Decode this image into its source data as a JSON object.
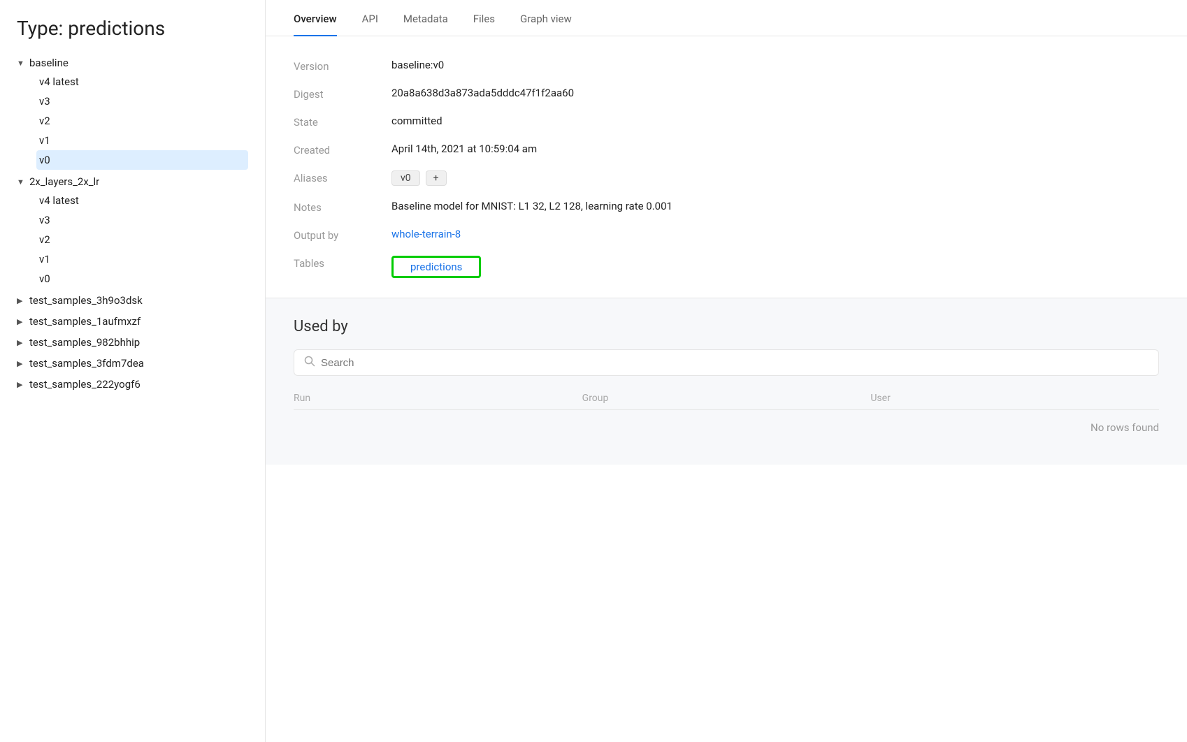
{
  "page_title": "Type: predictions",
  "sidebar": {
    "title": "Type: predictions",
    "sections": [
      {
        "id": "baseline",
        "label": "baseline",
        "expanded": true,
        "children": [
          {
            "label": "v4 latest",
            "active": false
          },
          {
            "label": "v3",
            "active": false
          },
          {
            "label": "v2",
            "active": false
          },
          {
            "label": "v1",
            "active": false
          },
          {
            "label": "v0",
            "active": true
          }
        ]
      },
      {
        "id": "2x_layers_2x_lr",
        "label": "2x_layers_2x_lr",
        "expanded": true,
        "children": [
          {
            "label": "v4 latest",
            "active": false
          },
          {
            "label": "v3",
            "active": false
          },
          {
            "label": "v2",
            "active": false
          },
          {
            "label": "v1",
            "active": false
          },
          {
            "label": "v0",
            "active": false
          }
        ]
      }
    ],
    "collapsed_items": [
      "test_samples_3h9o3dsk",
      "test_samples_1aufmxzf",
      "test_samples_982bhhip",
      "test_samples_3fdm7dea",
      "test_samples_222yogf6"
    ]
  },
  "tabs": [
    {
      "label": "Overview",
      "active": true
    },
    {
      "label": "API",
      "active": false
    },
    {
      "label": "Metadata",
      "active": false
    },
    {
      "label": "Files",
      "active": false
    },
    {
      "label": "Graph view",
      "active": false
    }
  ],
  "overview": {
    "fields": [
      {
        "label": "Version",
        "value": "baseline:v0",
        "type": "text"
      },
      {
        "label": "Digest",
        "value": "20a8a638d3a873ada5dddc47f1f2aa60",
        "type": "text"
      },
      {
        "label": "State",
        "value": "committed",
        "type": "text"
      },
      {
        "label": "Created",
        "value": "April 14th, 2021 at 10:59:04 am",
        "type": "text"
      },
      {
        "label": "Aliases",
        "value": "",
        "type": "aliases"
      },
      {
        "label": "Notes",
        "value": "Baseline model for MNIST: L1 32, L2 128, learning rate 0.001",
        "type": "text"
      },
      {
        "label": "Output by",
        "value": "whole-terrain-8",
        "type": "link"
      },
      {
        "label": "Tables",
        "value": "predictions",
        "type": "predictions-link"
      }
    ],
    "alias_badge": "v0",
    "alias_add_label": "+",
    "output_by_link": "whole-terrain-8",
    "tables_link": "predictions"
  },
  "used_by": {
    "title": "Used by",
    "search_placeholder": "Search",
    "columns": [
      "Run",
      "Group",
      "User"
    ],
    "no_rows_text": "No rows found"
  }
}
